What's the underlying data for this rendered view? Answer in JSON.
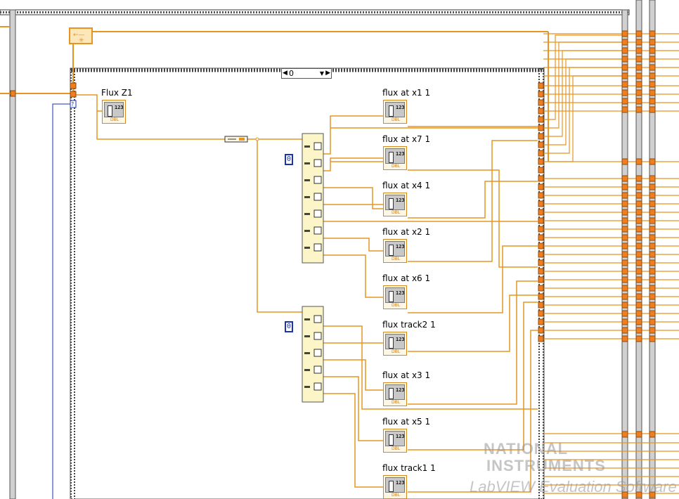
{
  "case_selector": {
    "value": "0"
  },
  "indicators": [
    {
      "label": "Flux Z1",
      "type": "DBL"
    },
    {
      "label": "flux at x1 1",
      "type": "DBL"
    },
    {
      "label": "flux at x7 1",
      "type": "DBL"
    },
    {
      "label": "flux at x4 1",
      "type": "DBL"
    },
    {
      "label": "flux at x2 1",
      "type": "DBL"
    },
    {
      "label": "flux at x6 1",
      "type": "DBL"
    },
    {
      "label": "flux track2 1",
      "type": "DBL"
    },
    {
      "label": "flux at x3 1",
      "type": "DBL"
    },
    {
      "label": "flux at x5 1",
      "type": "DBL"
    },
    {
      "label": "flux track1  1",
      "type": "DBL"
    }
  ],
  "index_glyph": "123",
  "constants": [
    {
      "value": "0"
    },
    {
      "value": "0"
    }
  ],
  "watermark": {
    "line1": "NATIONAL",
    "line2": "INSTRUMENTS",
    "line3": "LabVIEW Evaluation Software"
  },
  "colors": {
    "wire_orange": "#e69522",
    "wire_blue": "#1a33b0",
    "frame_gray": "#777777",
    "terminal_orange": "#f07d1e",
    "index_array_fill": "#fbf5c8"
  }
}
